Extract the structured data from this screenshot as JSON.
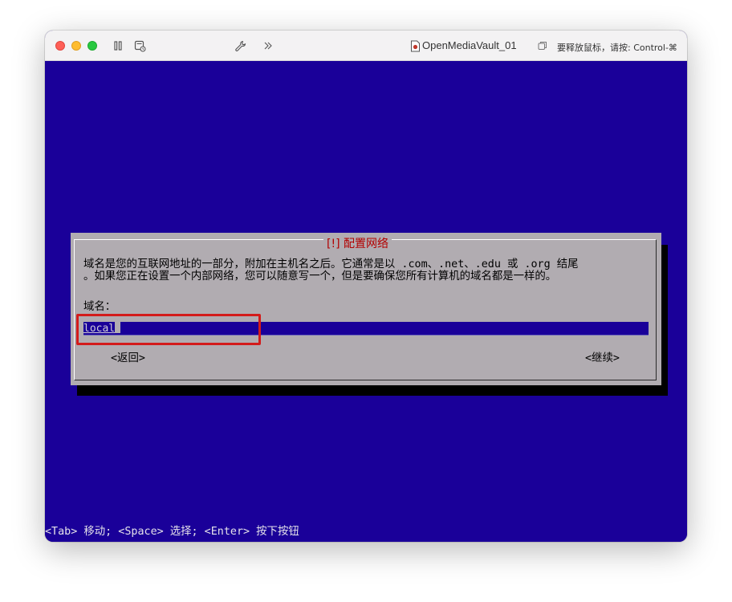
{
  "window": {
    "title": "OpenMediaVault_01",
    "hint": "要释放鼠标，请按: Control-⌘"
  },
  "dialog": {
    "title": "[!] 配置网络",
    "text_line1": "域名是您的互联网地址的一部分，附加在主机名之后。它通常是以 .com、.net、.edu 或 .org 结尾",
    "text_line2": "。如果您正在设置一个内部网络，您可以随意写一个，但是要确保您所有计算机的域名都是一样的。",
    "field_label": "域名：",
    "field_value": "local",
    "back_button": "<返回>",
    "continue_button": "<继续>"
  },
  "statusbar": {
    "text": "<Tab> 移动; <Space> 选择; <Enter> 按下按钮"
  },
  "colors": {
    "screen_bg": "#1a0099",
    "dialog_bg": "#b1acb1",
    "title_red": "#b20000",
    "highlight": "#d31b1b"
  },
  "icons": {
    "pause": "pause-icon",
    "snapshot": "snapshot-icon",
    "settings": "wrench-icon",
    "more": "chevron-double-right-icon",
    "vm_doc": "vm-document-icon",
    "window_copy": "window-copy-icon"
  }
}
